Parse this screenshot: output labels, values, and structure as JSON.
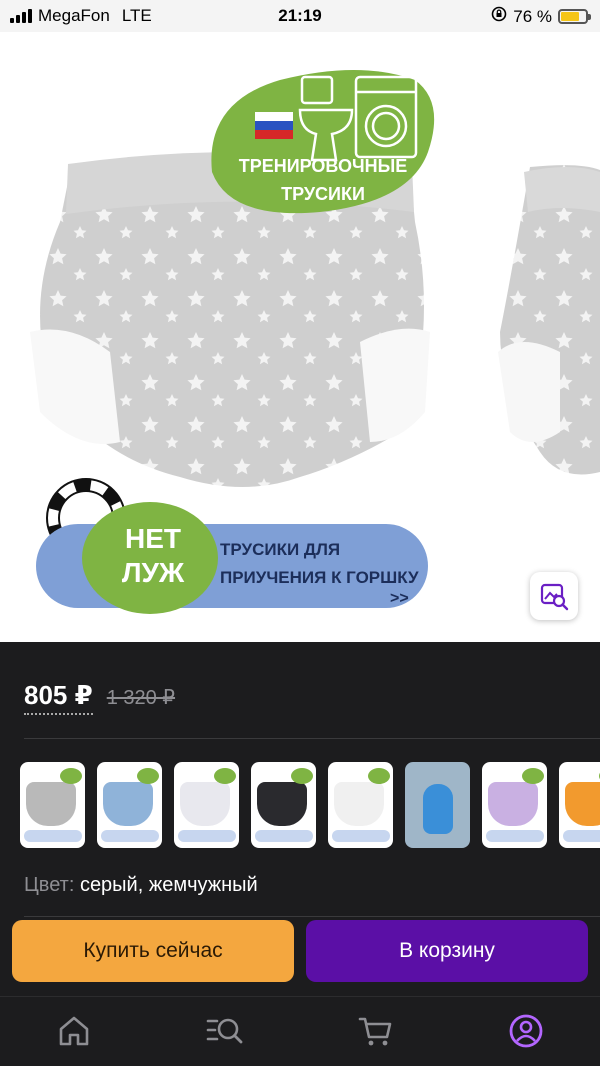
{
  "status_bar": {
    "carrier": "MegaFon",
    "network": "LTE",
    "time": "21:19",
    "battery_percent": "76 %",
    "battery_level": 0.76
  },
  "gallery": {
    "badge_line1": "ТРЕНИРОВОЧНЫЕ",
    "badge_line2": "ТРУСИКИ",
    "circle_line1": "НЕТ",
    "circle_line2": "ЛУЖ",
    "banner_line1": "ТРУСИКИ ДЛЯ",
    "banner_line2": "ПРИУЧЕНИЯ К ГОРШКУ",
    "banner_arrows": ">>",
    "icons": {
      "back": "chevron-left-icon",
      "favorite": "heart-icon",
      "share": "share-icon",
      "image_search": "image-search-icon"
    },
    "colors": {
      "badge_green": "#7fb443",
      "banner_blue": "#7f9fd6"
    }
  },
  "product": {
    "price": "805 ₽",
    "old_price": "1 320 ₽",
    "color_label": "Цвет:",
    "color_value": "серый, жемчужный",
    "thumbnails": [
      {
        "variant": "grey",
        "color": "#b9b9b9"
      },
      {
        "variant": "blue-pattern",
        "color": "#8fb3d9"
      },
      {
        "variant": "white-stars",
        "color": "#e8e8ee"
      },
      {
        "variant": "black",
        "color": "#2a2a2e"
      },
      {
        "variant": "white",
        "color": "#f0f0f0"
      },
      {
        "variant": "photo-child",
        "color": "#9fb6c8"
      },
      {
        "variant": "lilac",
        "color": "#c9b0e2"
      },
      {
        "variant": "orange",
        "color": "#f29a2e"
      }
    ]
  },
  "actions": {
    "buy_now": "Купить сейчас",
    "add_to_cart": "В корзину",
    "buy_now_color": "#f4a73f",
    "cart_color": "#5b0fa6"
  },
  "tabbar": {
    "items": [
      {
        "name": "home",
        "icon": "home-icon"
      },
      {
        "name": "catalog",
        "icon": "catalog-search-icon"
      },
      {
        "name": "cart",
        "icon": "cart-icon"
      },
      {
        "name": "profile",
        "icon": "profile-icon",
        "active": true
      }
    ],
    "active_color": "#b366ff"
  }
}
